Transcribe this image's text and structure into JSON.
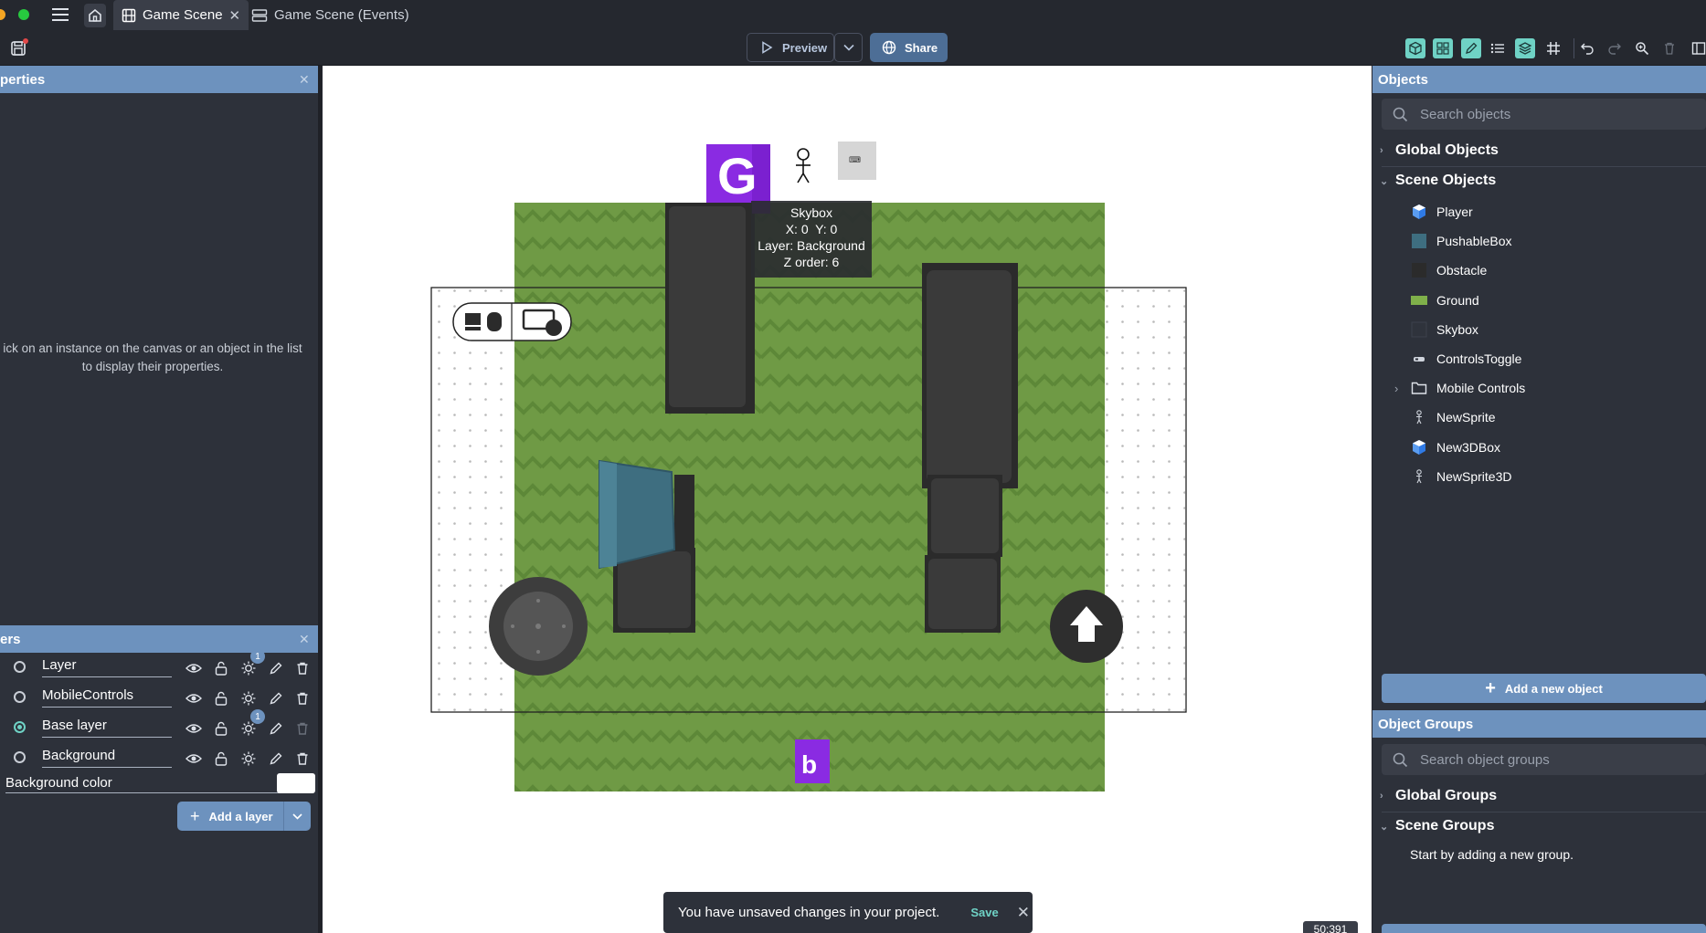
{
  "tabs": [
    {
      "label": "Game Scene",
      "icon": "film-icon",
      "active": true
    },
    {
      "label": "Game Scene (Events)",
      "icon": "events-icon",
      "active": false
    }
  ],
  "toolbar": {
    "preview_label": "Preview",
    "share_label": "Share"
  },
  "properties_panel": {
    "title": "perties",
    "hint": "ick on an instance on the canvas or an object in the list to display their properties."
  },
  "layers_panel": {
    "title": "ers",
    "layers": [
      {
        "name": "Layer",
        "selected": false,
        "badge": "1"
      },
      {
        "name": "MobileControls",
        "selected": false,
        "badge": ""
      },
      {
        "name": "Base layer",
        "selected": true,
        "badge": "1"
      },
      {
        "name": "Background",
        "selected": false,
        "badge": ""
      }
    ],
    "background_color_label": "Background color",
    "background_color": "#ffffff",
    "add_layer_label": "Add a layer"
  },
  "canvas": {
    "tooltip": {
      "name": "Skybox",
      "position": "X: 0  Y: 0",
      "layer": "Layer: Background",
      "zorder": "Z order: 6"
    },
    "coords": "50;391",
    "ground_color": "#6f9a45",
    "obstacle_color": "#333333",
    "pushable_color": "#3e6e80"
  },
  "snackbar": {
    "message": "You have unsaved changes in your project.",
    "save_label": "Save"
  },
  "objects_panel": {
    "title": "Objects",
    "search_placeholder": "Search objects",
    "global_label": "Global Objects",
    "scene_label": "Scene Objects",
    "objects": [
      {
        "name": "Player",
        "icon": "cube-icon"
      },
      {
        "name": "PushableBox",
        "icon": "teal-square-icon"
      },
      {
        "name": "Obstacle",
        "icon": "dark-square-icon"
      },
      {
        "name": "Ground",
        "icon": "green-rect-icon"
      },
      {
        "name": "Skybox",
        "icon": "skybox-icon"
      },
      {
        "name": "ControlsToggle",
        "icon": "controls-icon"
      },
      {
        "name": "Mobile Controls",
        "icon": "folder-icon"
      },
      {
        "name": "NewSprite",
        "icon": "stick-figure-icon"
      },
      {
        "name": "New3DBox",
        "icon": "cube-icon"
      },
      {
        "name": "NewSprite3D",
        "icon": "stick-figure-icon"
      }
    ],
    "add_object_label": "Add a new object"
  },
  "groups_panel": {
    "title": "Object Groups",
    "search_placeholder": "Search object groups",
    "global_label": "Global Groups",
    "scene_label": "Scene Groups",
    "empty_hint": "Start by adding a new group."
  }
}
